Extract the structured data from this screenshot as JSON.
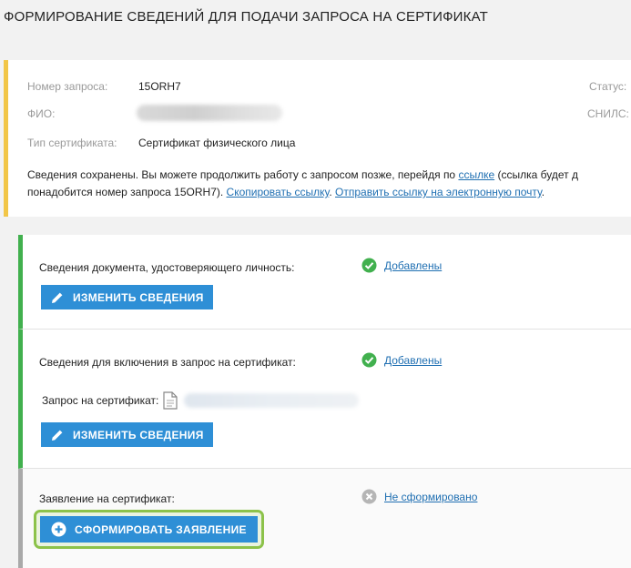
{
  "header": {
    "title": "ФОРМИРОВАНИЕ СВЕДЕНИЙ ДЛЯ ПОДАЧИ ЗАПРОСА НА СЕРТИФИКАТ"
  },
  "info": {
    "request_number_label": "Номер запроса:",
    "request_number_value": "15ORH7",
    "fio_label": "ФИО:",
    "cert_type_label": "Тип сертификата:",
    "cert_type_value": "Сертификат физического лица",
    "status_label": "Статус:",
    "snils_label": "СНИЛС:",
    "notice": {
      "part1": "Сведения сохранены. Вы можете продолжить работу с запросом позже, перейдя по ",
      "link_text": "ссылке",
      "part2": " (ссылка будет д",
      "part3": "понадобится номер запроса 15ORH7). ",
      "copy_link": "Скопировать ссылку",
      "part4": ". ",
      "send_link": "Отправить ссылку на электронную почту",
      "part5": "."
    }
  },
  "steps": [
    {
      "label": "Сведения документа, удостоверяющего личность:",
      "status": "Добавлены",
      "status_icon": "check-circle-icon",
      "button": "ИЗМЕНИТЬ СВЕДЕНИЯ"
    },
    {
      "label": "Сведения для включения в запрос на сертификат:",
      "status": "Добавлены",
      "status_icon": "check-circle-icon",
      "sublabel": "Запрос на сертификат:",
      "button": "ИЗМЕНИТЬ СВЕДЕНИЯ"
    },
    {
      "label": "Заявление на сертификат:",
      "status": "Не сформировано",
      "status_icon": "cross-circle-icon",
      "button": "СФОРМИРОВАТЬ ЗАЯВЛЕНИЕ"
    }
  ],
  "colors": {
    "accent": "#2e8fd6",
    "success": "#41b04e",
    "warning": "#f2c648",
    "pending": "#a9a9a9",
    "highlight": "#8cc24a",
    "link": "#1f6fb2"
  }
}
